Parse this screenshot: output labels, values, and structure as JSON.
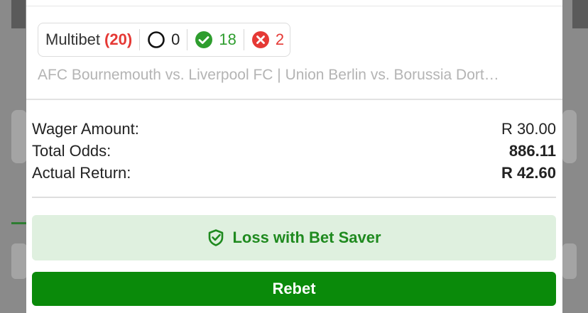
{
  "summary": {
    "type_label": "Multibet",
    "count": "(20)",
    "pending": "0",
    "won": "18",
    "lost": "2"
  },
  "matches_text": "AFC Bournemouth vs. Liverpool FC | Union Berlin vs. Borussia Dort…",
  "details": {
    "wager_label": "Wager Amount:",
    "wager_value": "R 30.00",
    "odds_label": "Total Odds:",
    "odds_value": "886.11",
    "return_label": "Actual Return:",
    "return_value": "R 42.60"
  },
  "bet_saver_label": "Loss with Bet Saver",
  "rebet_label": "Rebet",
  "icons": {
    "pending": "circle-outline-icon",
    "won": "check-circle-icon",
    "lost": "x-circle-icon",
    "bet_saver": "shield-check-icon"
  },
  "colors": {
    "won": "#2e9d2e",
    "lost": "#e53935",
    "primary": "#0a8a0a",
    "bet_saver_bg": "#dff0df"
  }
}
